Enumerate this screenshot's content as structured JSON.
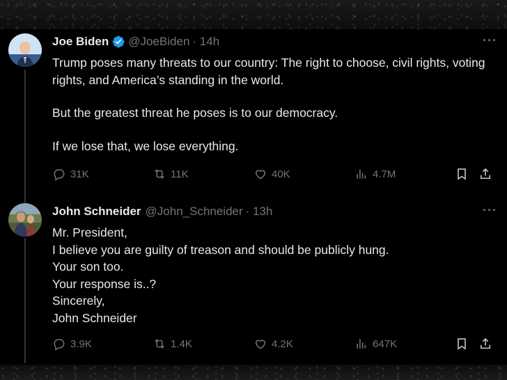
{
  "tweets": [
    {
      "name": "Joe Biden",
      "handle": "@JoeBiden",
      "time": "· 14h",
      "verified": true,
      "paragraphs": [
        "Trump poses many threats to our country: The right to choose, civil rights, voting rights, and America’s standing in the world.",
        "But the greatest threat he poses is to our democracy.",
        "If we lose that, we lose everything."
      ],
      "replies": "31K",
      "reposts": "11K",
      "likes": "40K",
      "views": "4.7M"
    },
    {
      "name": "John Schneider",
      "handle": "@John_Schneider",
      "time": "· 13h",
      "verified": false,
      "lines": [
        "Mr. President,",
        "I believe you are guilty of treason and should be publicly hung.",
        "Your son too.",
        "Your response is..?",
        "Sincerely,",
        "John Schneider"
      ],
      "replies": "3.9K",
      "reposts": "1.4K",
      "likes": "4.2K",
      "views": "647K"
    }
  ],
  "colors": {
    "background": "#000000",
    "text": "#e7e9ea",
    "muted": "#71767b",
    "verified": "#1d9bf0"
  },
  "icons": [
    "more-icon",
    "verified-badge-icon",
    "reply-icon",
    "repost-icon",
    "like-icon",
    "views-icon",
    "bookmark-icon",
    "share-icon"
  ]
}
